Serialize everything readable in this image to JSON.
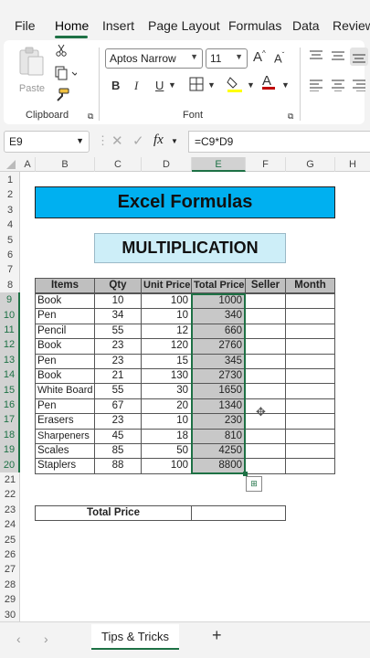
{
  "menu": {
    "tabs": [
      "File",
      "Home",
      "Insert",
      "Page Layout",
      "Formulas",
      "Data",
      "Review"
    ],
    "active": "Home"
  },
  "ribbon": {
    "clipboard": {
      "paste_label": "Paste",
      "group_label": "Clipboard"
    },
    "font": {
      "font_name": "Aptos Narrow",
      "font_size": "11",
      "bold": "B",
      "italic": "I",
      "underline": "U",
      "group_label": "Font"
    },
    "fill_color": "#ffff00",
    "font_color": "#c00000"
  },
  "formula_bar": {
    "cell_ref": "E9",
    "fx": "fx",
    "formula": "=C9*D9"
  },
  "grid": {
    "columns": [
      "A",
      "B",
      "C",
      "D",
      "E",
      "F",
      "G",
      "H"
    ],
    "rows": [
      "1",
      "2",
      "3",
      "4",
      "5",
      "6",
      "7",
      "8",
      "9",
      "10",
      "11",
      "12",
      "13",
      "14",
      "15",
      "16",
      "17",
      "18",
      "19",
      "20",
      "21",
      "22",
      "23",
      "24",
      "25",
      "26",
      "27",
      "28",
      "29",
      "30"
    ],
    "title": "Excel Formulas",
    "subtitle": "MULTIPLICATION",
    "title_color": "#00b0f0",
    "subtitle_color": "#cdeef8",
    "headers": [
      "Items",
      "Qty",
      "Unit Price",
      "Total Price",
      "Seller",
      "Month"
    ],
    "header_color": "#bfbfbf",
    "selection_color": "#c8c8c8",
    "data_rows": [
      {
        "item": "Book",
        "qty": "10",
        "unit_price": "100",
        "total_price": "1000"
      },
      {
        "item": "Pen",
        "qty": "34",
        "unit_price": "10",
        "total_price": "340"
      },
      {
        "item": "Pencil",
        "qty": "55",
        "unit_price": "12",
        "total_price": "660"
      },
      {
        "item": "Book",
        "qty": "23",
        "unit_price": "120",
        "total_price": "2760"
      },
      {
        "item": "Pen",
        "qty": "23",
        "unit_price": "15",
        "total_price": "345"
      },
      {
        "item": "Book",
        "qty": "21",
        "unit_price": "130",
        "total_price": "2730"
      },
      {
        "item": "White Board",
        "qty": "55",
        "unit_price": "30",
        "total_price": "1650"
      },
      {
        "item": "Pen",
        "qty": "67",
        "unit_price": "20",
        "total_price": "1340"
      },
      {
        "item": "Erasers",
        "qty": "23",
        "unit_price": "10",
        "total_price": "230"
      },
      {
        "item": "Sharpeners",
        "qty": "45",
        "unit_price": "18",
        "total_price": "810"
      },
      {
        "item": "Scales",
        "qty": "85",
        "unit_price": "50",
        "total_price": "4250"
      },
      {
        "item": "Staplers",
        "qty": "88",
        "unit_price": "100",
        "total_price": "8800"
      }
    ],
    "total_label": "Total Price"
  },
  "sheets": {
    "tabs": [
      "Tips & Tricks"
    ],
    "add_label": "+"
  }
}
